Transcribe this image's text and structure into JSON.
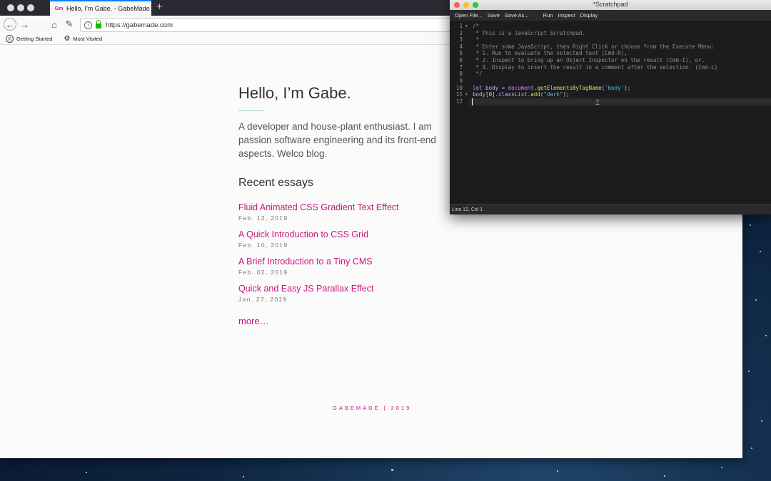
{
  "browser": {
    "tab_title": "Hello, I'm Gabe. - GabeMade",
    "tab_favicon_text": "Gm",
    "url": "https://gabemade.com",
    "bookmarks": [
      "Getting Started",
      "Most Visited"
    ]
  },
  "page": {
    "heading": "Hello, I’m Gabe.",
    "intro": "A developer and house-plant enthusiast. I am passion software engineering and its front-end aspects. Welco blog.",
    "essays_heading": "Recent essays",
    "essays": [
      {
        "title": "Fluid Animated CSS Gradient Text Effect",
        "date": "Feb. 12, 2019"
      },
      {
        "title": "A Quick Introduction to CSS Grid",
        "date": "Feb. 10, 2019"
      },
      {
        "title": "A Brief Introduction to a Tiny CMS",
        "date": "Feb. 02, 2019"
      },
      {
        "title": "Quick and Easy JS Parallax Effect",
        "date": "Jan. 27, 2019"
      }
    ],
    "more_link": "more…",
    "footer": "GABEMADE | 2019"
  },
  "scratchpad": {
    "title": "*Scratchpad",
    "menu": [
      "Open File...",
      "Save",
      "Save As...",
      "Run",
      "Inspect",
      "Display"
    ],
    "line_numbers": [
      "1",
      "2",
      "3",
      "4",
      "5",
      "6",
      "7",
      "8",
      "9",
      "10",
      "11",
      "12"
    ],
    "comment_lines": [
      "/*",
      " * This is a JavaScript Scratchpad.",
      " *",
      " * Enter some JavaScript, then Right Click or choose from the Execute Menu:",
      " * 1. Run to evaluate the selected text (Cmd-R),",
      " * 2. Inspect to bring up an Object Inspector on the result (Cmd-I), or,",
      " * 3. Display to insert the result in a comment after the selection. (Cmd-L)",
      " */"
    ],
    "code": {
      "l10_kw": "let",
      "l10_var": " body = ",
      "l10_obj": "document",
      "l10_dot": ".",
      "l10_fn": "getElementsByTagName",
      "l10_open": "(",
      "l10_str": "'body'",
      "l10_close": ");",
      "l11_obj": "body",
      "l11_idx": "[0].",
      "l11_prop": "classList",
      "l11_dot": ".",
      "l11_fn": "add",
      "l11_open": "(",
      "l11_str": "\"dark\"",
      "l11_close": ");"
    },
    "status": "Line 12, Col 1"
  },
  "colors": {
    "accent": "#c8177c",
    "lock": "#12bc00"
  }
}
